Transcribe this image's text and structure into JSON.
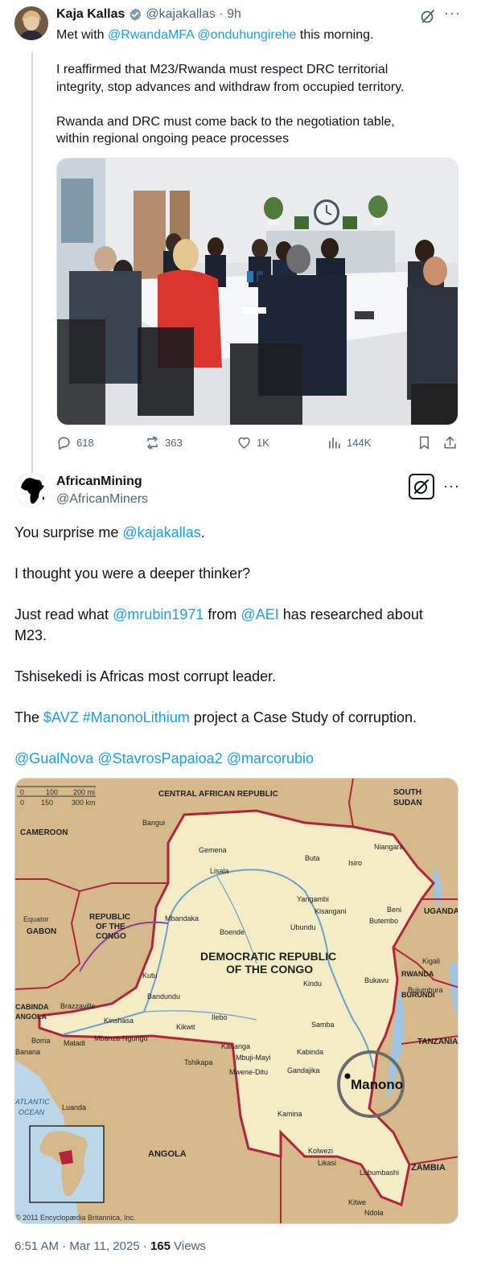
{
  "parent_tweet": {
    "author_name": "Kaja Kallas",
    "handle": "@kajakallas",
    "time": "9h",
    "lines": [
      [
        {
          "t": "Met with "
        },
        {
          "t": "@RwandaMFA",
          "link": true
        },
        {
          "t": " "
        },
        {
          "t": "@onduhungirehe",
          "link": true
        },
        {
          "t": " this morning."
        }
      ],
      [],
      [
        {
          "t": "I reaffirmed that M23/Rwanda must respect DRC territorial"
        }
      ],
      [
        {
          "t": "integrity, stop advances and withdraw from occupied territory."
        }
      ],
      [],
      [
        {
          "t": "Rwanda and DRC must come back to the negotiation table,"
        }
      ],
      [
        {
          "t": "within regional ongoing peace processes"
        }
      ]
    ],
    "stats": {
      "replies": "618",
      "reposts": "363",
      "likes": "1K",
      "views": "144K"
    }
  },
  "reply_tweet": {
    "author_name": "AfricanMining",
    "handle": "@AfricanMiners",
    "lines": [
      [
        {
          "t": "You surprise me "
        },
        {
          "t": "@kajakallas",
          "link": true
        },
        {
          "t": "."
        }
      ],
      [],
      [
        {
          "t": "I thought you were a deeper thinker?"
        }
      ],
      [],
      [
        {
          "t": "Just read what "
        },
        {
          "t": "@mrubin1971",
          "link": true
        },
        {
          "t": " from "
        },
        {
          "t": "@AEI",
          "link": true
        },
        {
          "t": " has researched about"
        }
      ],
      [
        {
          "t": "M23."
        }
      ],
      [],
      [
        {
          "t": "Tshisekedi is Africas most corrupt leader."
        }
      ],
      [],
      [
        {
          "t": "The "
        },
        {
          "t": "$AVZ",
          "link": true
        },
        {
          "t": " "
        },
        {
          "t": "#ManonoLithium",
          "link": true
        },
        {
          "t": " project a Case Study of corruption."
        }
      ],
      [],
      [
        {
          "t": "@GualNova",
          "link": true
        },
        {
          "t": " "
        },
        {
          "t": "@StavrosPapaioa2",
          "link": true
        },
        {
          "t": " "
        },
        {
          "t": "@marcorubio",
          "link": true
        }
      ]
    ],
    "footer": {
      "time": "6:51 AM · Mar 11, 2025 · ",
      "views_count": "165",
      "views_label": " Views"
    }
  },
  "map": {
    "countries": {
      "car": "CENTRAL AFRICAN REPUBLIC",
      "south_sudan_1": "SOUTH",
      "south_sudan_2": "SUDAN",
      "cameroon": "CAMEROON",
      "equator": "Equator",
      "gabon": "GABON",
      "roc_1": "REPUBLIC",
      "roc_2": "OF THE",
      "roc_3": "CONGO",
      "drc_1": "DEMOCRATIC REPUBLIC",
      "drc_2": "OF THE CONGO",
      "uganda": "UGANDA",
      "rwanda": "RWANDA",
      "burundi": "BURUNDI",
      "tanzania": "TANZANIA",
      "cabinda_1": "CABINDA",
      "cabinda_2": "ANGOLA",
      "angola": "ANGOLA",
      "zambia": "ZAMBIA",
      "ocean_1": "ATLANTIC",
      "ocean_2": "OCEAN"
    },
    "cities": {
      "bangui": "Bangui",
      "gemena": "Gemena",
      "buta": "Buta",
      "niangara": "Niangara",
      "isiro": "Isiro",
      "lisala": "Lisala",
      "yangambi": "Yangambi",
      "kisangani": "Kisangani",
      "beni": "Beni",
      "butembo": "Butembo",
      "mbandaka": "Mbandaka",
      "boende": "Boende",
      "ubundu": "Ubundu",
      "kigali": "Kigali",
      "bukavu": "Bukavu",
      "bujumbura": "Bujumbura",
      "kutu": "Kutu",
      "kindu": "Kindu",
      "bandundu": "Bandundu",
      "brazzaville": "Brazzaville",
      "kinshasa": "Kinshasa",
      "ilebo": "Ilebo",
      "kikwit": "Kikwit",
      "samba": "Samba",
      "boma": "Boma",
      "matadi": "Matadi",
      "mbanza": "Mbanza-Ngungu",
      "banana": "Banana",
      "kananga": "Kananga",
      "mbujimayi": "Mbuji-Mayi",
      "kabinda": "Kabinda",
      "tshikapa": "Tshikapa",
      "mwene": "Mwene-Ditu",
      "gandajika": "Gandajika",
      "manono": "Manono",
      "kamina": "Kamina",
      "luanda": "Luanda",
      "kolwezi": "Kolwezi",
      "likasi": "Likasi",
      "lubumbashi": "Lubumbashi",
      "kitwe": "Kitwe",
      "ndola": "Ndola"
    },
    "scale": {
      "top": [
        "0",
        "100",
        "200 mi"
      ],
      "bottom": [
        "0",
        "150",
        "300 km"
      ]
    },
    "copyright": "© 2011 Encyclopædia Britannica, Inc."
  }
}
